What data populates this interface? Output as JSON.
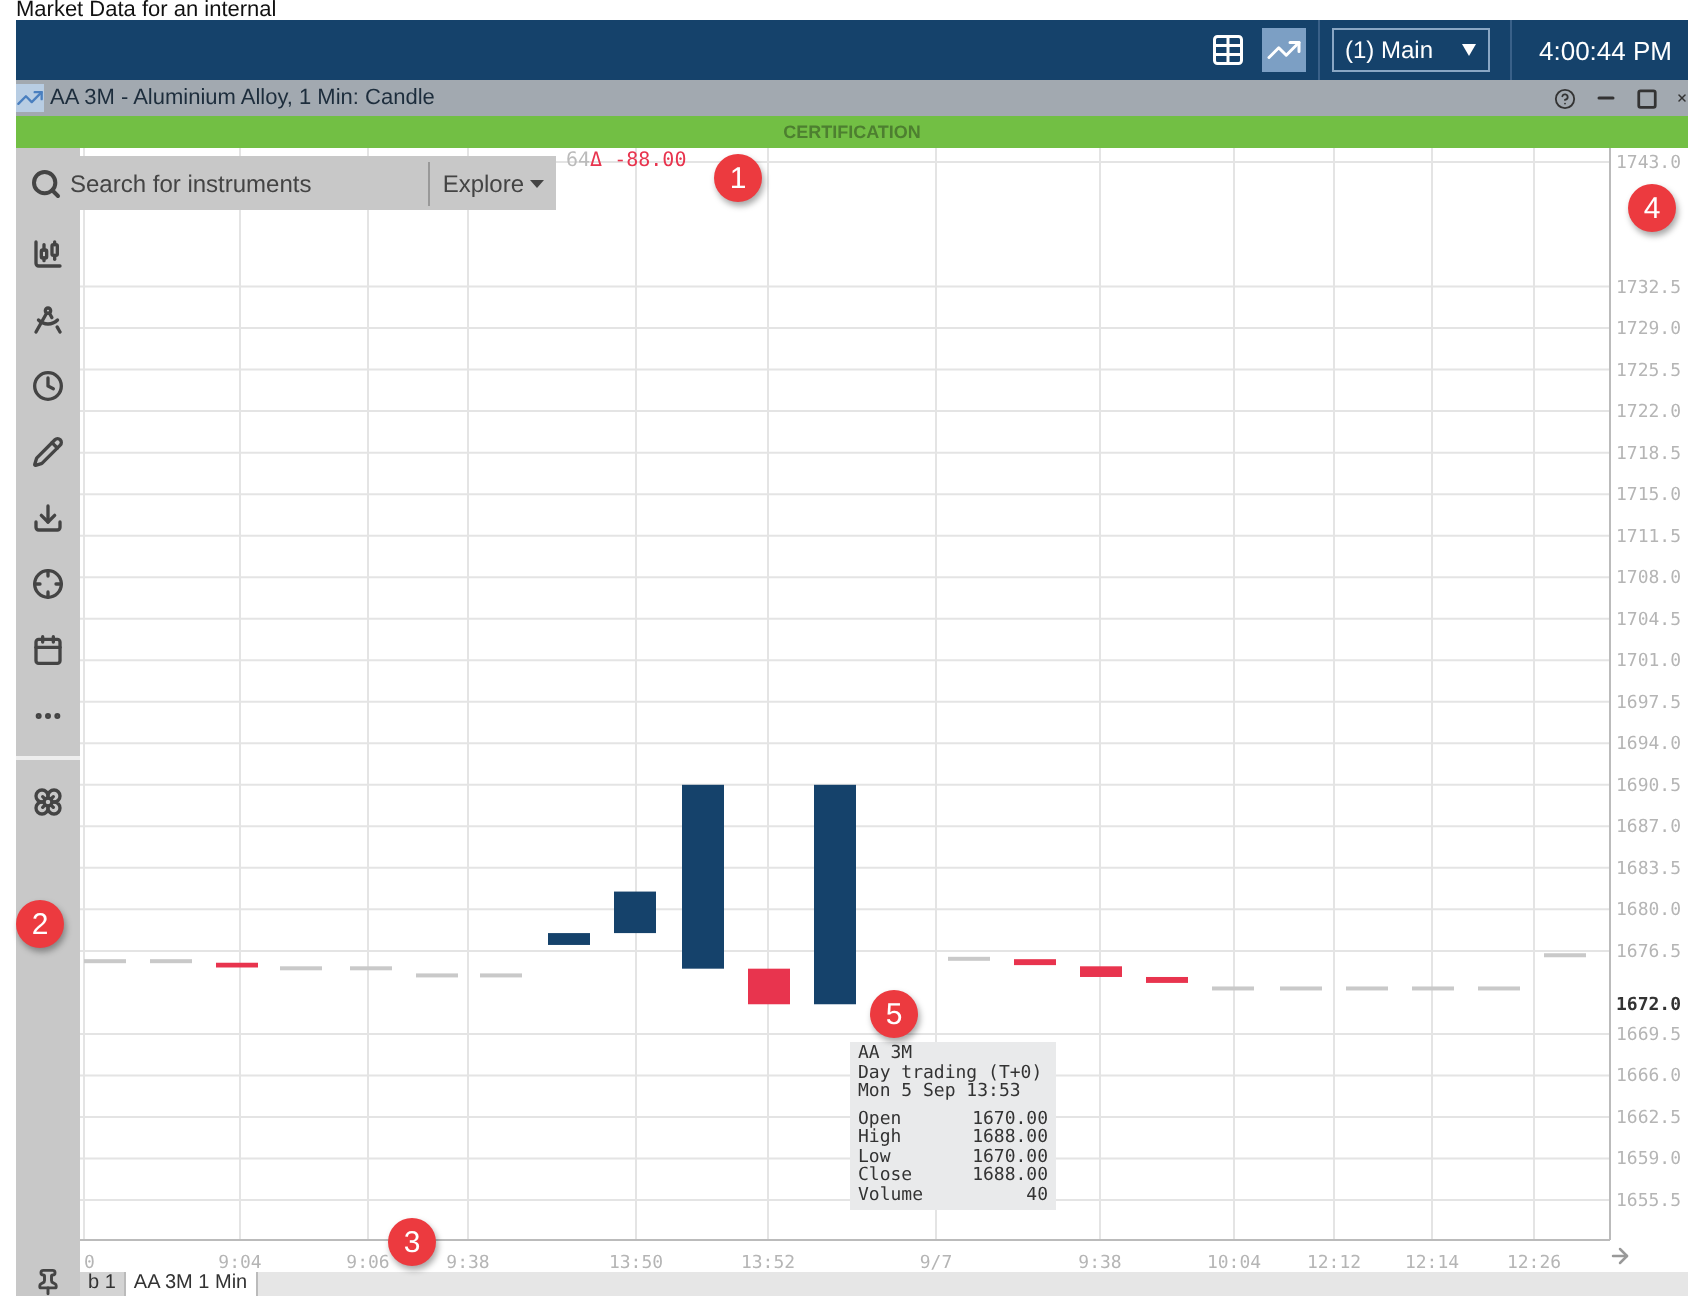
{
  "heading": "Market Data for an internal",
  "top_bar": {
    "workspace": "(1) Main",
    "clock": "4:00:44 PM",
    "chart_view_selected": true
  },
  "window": {
    "title": "AA 3M - Aluminium Alloy, 1 Min: Candle"
  },
  "environment_banner": "CERTIFICATION",
  "search": {
    "placeholder": "Search for instruments",
    "explore": "Explore"
  },
  "change": {
    "prefix": "64",
    "delta": "Δ -88.00"
  },
  "y_axis_labels": [
    "1743.0",
    "1732.5",
    "1729.0",
    "1725.5",
    "1722.0",
    "1718.5",
    "1715.0",
    "1711.5",
    "1708.0",
    "1704.5",
    "1701.0",
    "1697.5",
    "1694.0",
    "1690.5",
    "1687.0",
    "1683.5",
    "1680.0",
    "1676.5",
    "1669.5",
    "1666.0",
    "1662.5",
    "1659.0",
    "1655.5"
  ],
  "price_label": "1672.0",
  "x_axis_labels": [
    "0",
    "9:04",
    "9:06",
    "9:38",
    "13:50",
    "13:52",
    "9/7",
    "9:38",
    "10:04",
    "12:12",
    "12:14",
    "12:26"
  ],
  "tooltip": {
    "lines": [
      "AA 3M",
      "Day trading (T+0)",
      "Mon 5 Sep 13:53"
    ],
    "rows": [
      {
        "label": "Open",
        "value": "1670.00"
      },
      {
        "label": "High",
        "value": "1688.00"
      },
      {
        "label": "Low",
        "value": "1670.00"
      },
      {
        "label": "Close",
        "value": "1688.00"
      },
      {
        "label": "Volume",
        "value": "40"
      }
    ]
  },
  "tabs": [
    {
      "label": "b 1",
      "selected": false
    },
    {
      "label": "AA 3M 1 Min",
      "selected": true
    }
  ],
  "callouts": [
    "1",
    "2",
    "3",
    "4",
    "5"
  ]
}
